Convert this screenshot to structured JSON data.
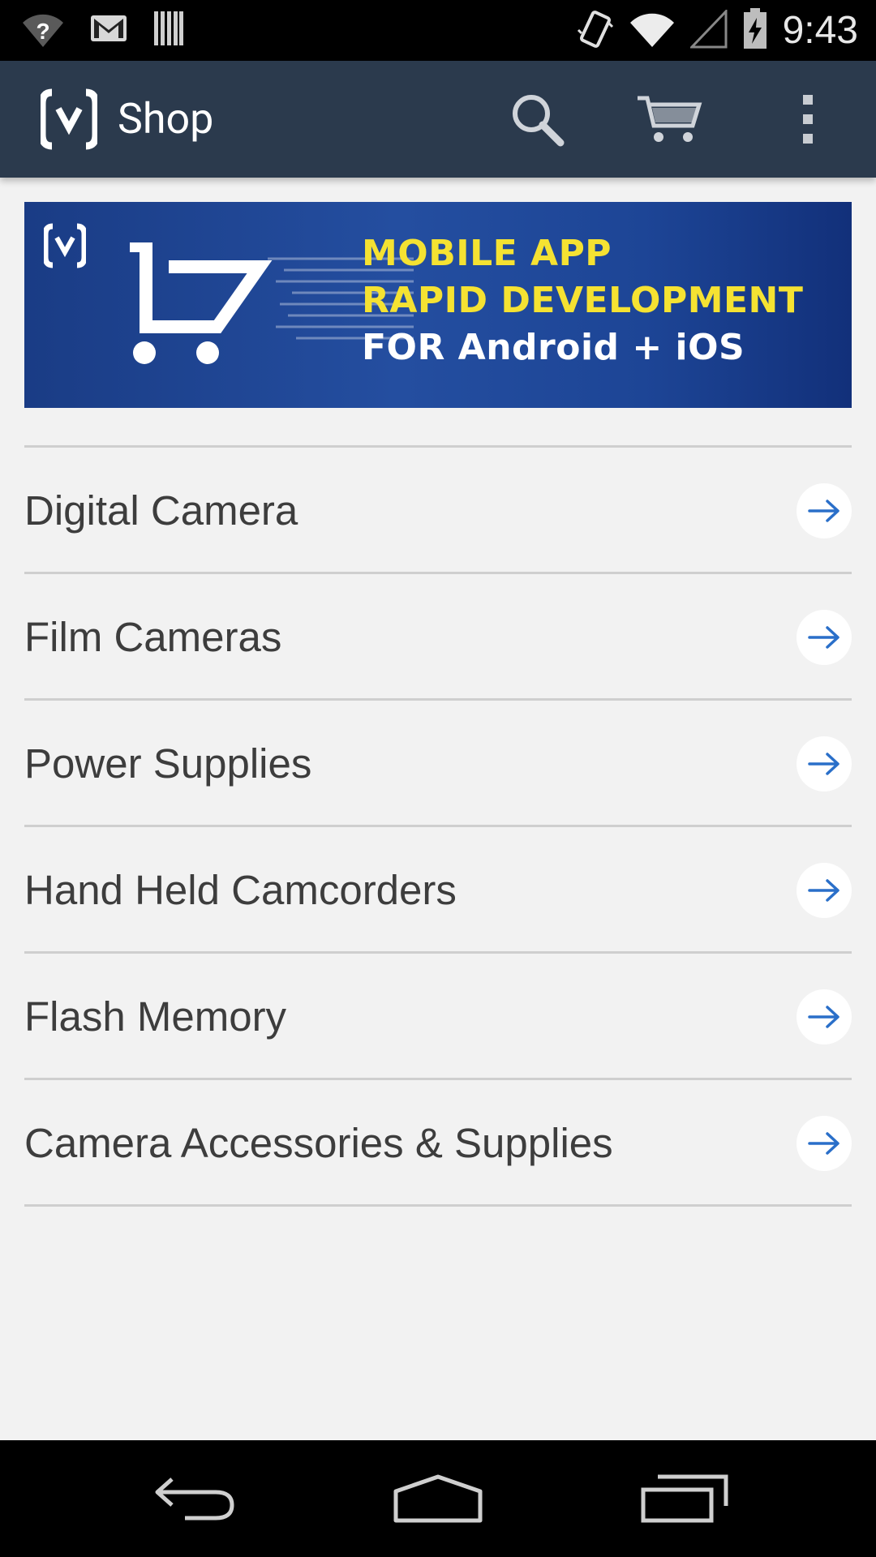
{
  "status_bar": {
    "time": "9:43",
    "icons": [
      "wifi-unknown-icon",
      "gmail-icon",
      "barcode-icon",
      "vibrate-icon",
      "wifi-icon",
      "signal-icon",
      "battery-charging-icon"
    ]
  },
  "app_bar": {
    "title": "Shop",
    "logo": "app-logo-icon",
    "actions": [
      "search-icon",
      "cart-icon",
      "overflow-menu-icon"
    ]
  },
  "banner": {
    "line1": "MOBILE APP",
    "line2": "RAPID DEVELOPMENT",
    "line3": "FOR Android + iOS",
    "accent_color": "#f5e232"
  },
  "categories": [
    {
      "label": "Digital Camera"
    },
    {
      "label": "Film Cameras"
    },
    {
      "label": "Power Supplies"
    },
    {
      "label": "Hand Held Camcorders"
    },
    {
      "label": "Flash Memory"
    },
    {
      "label": "Camera Accessories & Supplies"
    }
  ],
  "nav_bar": {
    "buttons": [
      "back-icon",
      "home-icon",
      "recents-icon"
    ]
  },
  "colors": {
    "app_bar": "#2b3a4d",
    "background": "#f2f2f2",
    "arrow": "#2a6fc9"
  }
}
